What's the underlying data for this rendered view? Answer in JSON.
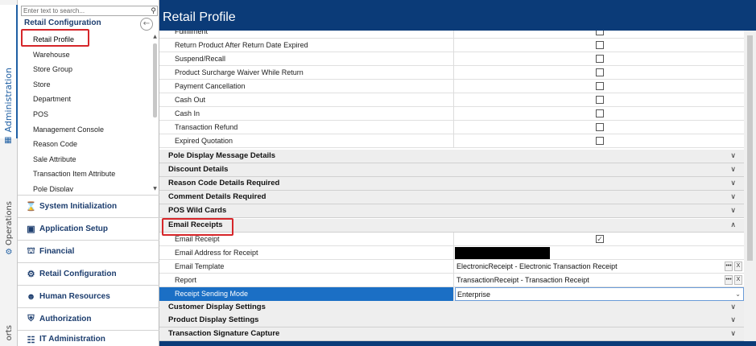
{
  "rail": {
    "tabs": [
      "Administration",
      "Operations",
      "orts"
    ]
  },
  "nav": {
    "search_placeholder": "Enter text to search...",
    "header": "Retail Configuration",
    "items": [
      {
        "label": "Retail Profile"
      },
      {
        "label": "Warehouse"
      },
      {
        "label": "Store Group"
      },
      {
        "label": "Store"
      },
      {
        "label": "Department"
      },
      {
        "label": "POS"
      },
      {
        "label": "Management Console"
      },
      {
        "label": "Reason Code"
      },
      {
        "label": "Sale Attribute"
      },
      {
        "label": "Transaction Item Attribute"
      },
      {
        "label": "Pole Display"
      }
    ],
    "modules": [
      {
        "label": "System Initialization",
        "icon": "hourglass-icon"
      },
      {
        "label": "Application Setup",
        "icon": "window-icon"
      },
      {
        "label": "Financial",
        "icon": "bank-icon"
      },
      {
        "label": "Retail Configuration",
        "icon": "gears-icon"
      },
      {
        "label": "Human Resources",
        "icon": "people-icon"
      },
      {
        "label": "Authorization",
        "icon": "shield-icon"
      },
      {
        "label": "IT Administration",
        "icon": "it-icon"
      }
    ]
  },
  "main": {
    "title": "Retail Profile",
    "rows_top": [
      {
        "label": "Fulfillment",
        "checked": false
      },
      {
        "label": "Return Product After Return Date Expired",
        "checked": false
      },
      {
        "label": "Suspend/Recall",
        "checked": false
      },
      {
        "label": "Product Surcharge Waiver While Return",
        "checked": false
      },
      {
        "label": "Payment Cancellation",
        "checked": false
      },
      {
        "label": "Cash Out",
        "checked": false
      },
      {
        "label": "Cash In",
        "checked": false
      },
      {
        "label": "Transaction Refund",
        "checked": false
      },
      {
        "label": "Expired Quotation",
        "checked": false
      }
    ],
    "groups_collapsed_a": [
      "Pole Display Message Details",
      "Discount Details",
      "Reason Code Details Required",
      "Comment Details Required",
      "POS Wild Cards"
    ],
    "email_group": "Email Receipts",
    "email_rows": {
      "email_receipt": {
        "label": "Email Receipt",
        "checked": true
      },
      "email_address": {
        "label": "Email Address for Receipt"
      },
      "email_template": {
        "label": "Email Template",
        "value": "ElectronicReceipt - Electronic Transaction Receipt"
      },
      "report": {
        "label": "Report",
        "value": "TransactionReceipt - Transaction Receipt"
      },
      "sending_mode": {
        "label": "Receipt Sending Mode",
        "value": "Enterprise"
      }
    },
    "groups_collapsed_b": [
      "Customer Display Settings",
      "Product Display Settings",
      "Transaction Signature Capture"
    ],
    "ellipsis": "•••",
    "clear": "X"
  },
  "colors": {
    "title_bar": "#0b3b78",
    "highlight": "#1b6fc5",
    "annotation": "#d6262a"
  }
}
